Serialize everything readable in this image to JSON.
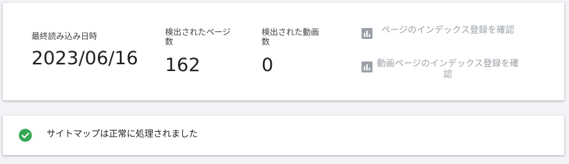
{
  "stats": {
    "last_read": {
      "label": "最終読み込み日時",
      "value": "2023/06/16"
    },
    "discovered_pages": {
      "label": "検出されたページ数",
      "value": "162"
    },
    "discovered_videos": {
      "label": "検出された動画数",
      "value": "0"
    }
  },
  "links": [
    {
      "label": "ページのインデックス登録を確認",
      "icon": "bar-chart-icon"
    },
    {
      "label": "動画ページのインデックス登録を確認",
      "icon": "bar-chart-icon"
    }
  ],
  "status": {
    "message": "サイトマップは正常に処理されました",
    "icon": "check-circle-icon",
    "color": "#34a853"
  },
  "colors": {
    "link_disabled": "#9aa0a6",
    "background": "#f1f3f6"
  }
}
